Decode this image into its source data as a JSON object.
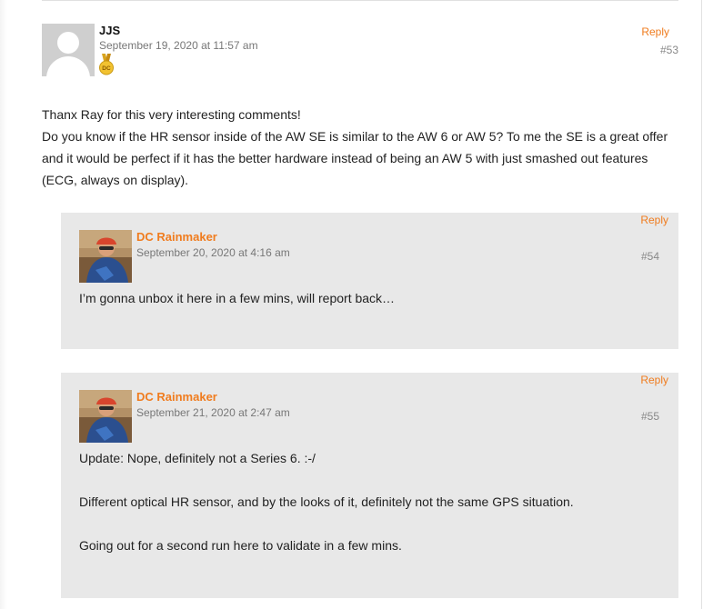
{
  "comments": [
    {
      "author": "JJS",
      "date": "September 19, 2020 at 11:57 am",
      "badge_text": "DC",
      "reply_label": "Reply",
      "number": "#53",
      "paragraphs": [
        "Thanx Ray for this very interesting comments!",
        "Do you know if the HR sensor inside of the AW SE is similar to the AW 6 or AW 5? To me the SE is a great offer and it would be perfect if it has the better hardware instead of being an AW 5 with just smashed out features (ECG, always on display)."
      ]
    }
  ],
  "replies": [
    {
      "author": "DC Rainmaker",
      "date": "September 20, 2020 at 4:16 am",
      "reply_label": "Reply",
      "number": "#54",
      "paragraphs": [
        "I’m gonna unbox it here in a few mins, will report back…"
      ]
    },
    {
      "author": "DC Rainmaker",
      "date": "September 21, 2020 at 2:47 am",
      "reply_label": "Reply",
      "number": "#55",
      "paragraphs": [
        "Update: Nope, definitely not a Series 6. :-/",
        "Different optical HR sensor, and by the looks of it, definitely not the same GPS situation.",
        "Going out for a second run here to validate in a few mins."
      ]
    }
  ],
  "colors": {
    "accent": "#f07c1e",
    "reply_background": "#e8e8e8",
    "meta_text": "#777777"
  },
  "icons": {
    "avatar_default": "default-person-avatar",
    "medal": "gold-medal-badge",
    "avatar_photo": "cyclist-photo-avatar"
  }
}
